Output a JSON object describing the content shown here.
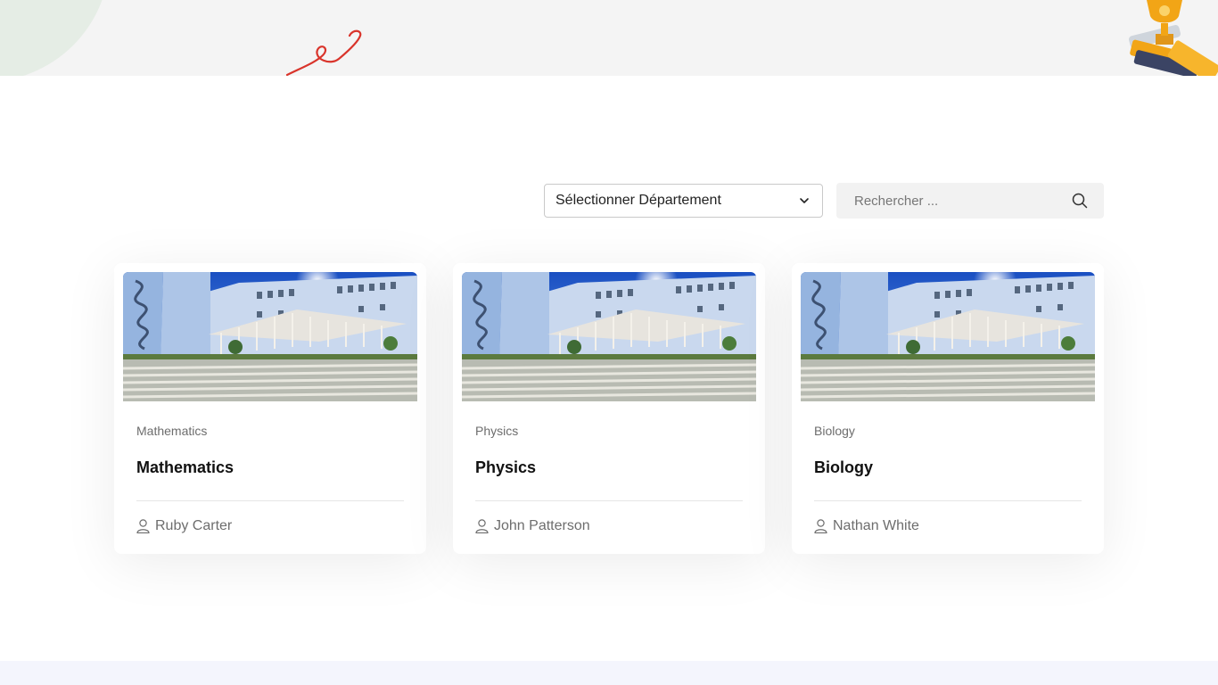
{
  "filters": {
    "department_label": "Sélectionner Département",
    "search_placeholder": "Rechercher ..."
  },
  "courses": [
    {
      "category": "Mathematics",
      "title": "Mathematics",
      "instructor": "Ruby Carter"
    },
    {
      "category": "Physics",
      "title": "Physics",
      "instructor": "John Patterson"
    },
    {
      "category": "Biology",
      "title": "Biology",
      "instructor": "Nathan White"
    }
  ],
  "icons": {
    "dropdown": "chevron-down-icon",
    "search": "search-icon",
    "instructor": "user-icon",
    "decor": "trophy-illustration"
  },
  "colors": {
    "banner_bg": "#f4f4f4",
    "squiggle": "#d9342b",
    "trophy": "#f2a516",
    "footer_bg": "#f4f5fd"
  }
}
